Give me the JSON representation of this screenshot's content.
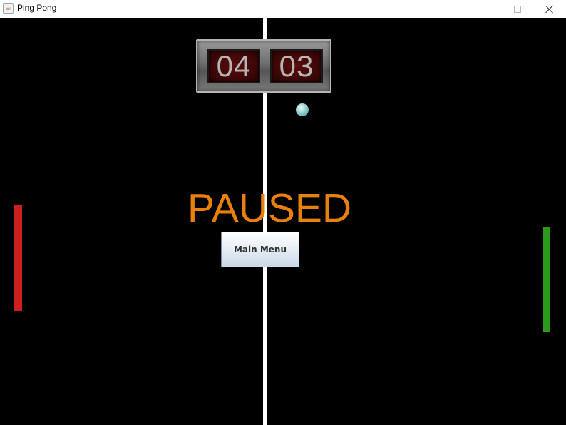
{
  "window": {
    "title": "Ping Pong",
    "icon": "java-cup-icon",
    "controls": [
      "minimize-icon",
      "maximize-icon",
      "close-icon"
    ]
  },
  "scoreboard": {
    "left_score": "04",
    "right_score": "03"
  },
  "status": {
    "paused_text": "PAUSED"
  },
  "menu": {
    "main_menu_label": "Main Menu"
  },
  "colors": {
    "background": "#000000",
    "net": "#ffffff",
    "left_paddle": "#cc1f1f",
    "right_paddle": "#2a9a1a",
    "paused_text": "#e8800c",
    "ball": "#7fc9c2"
  }
}
